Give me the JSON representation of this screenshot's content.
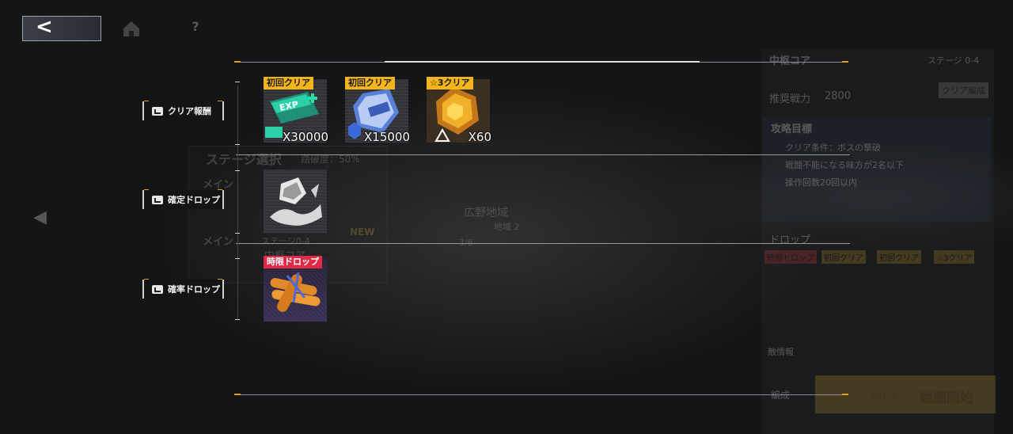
{
  "nav": {
    "back_icon": "chevron-left-icon",
    "home_icon": "home-icon",
    "help_label": "?"
  },
  "categories": [
    {
      "label": "クリア報酬"
    },
    {
      "label": "確定ドロップ"
    },
    {
      "label": "確率ドロップ"
    }
  ],
  "rewards": {
    "clear": [
      {
        "tag": "初回クリア",
        "qty": "X30000",
        "icon": "exp-ticket-icon"
      },
      {
        "tag": "初回クリア",
        "qty": "X15000",
        "icon": "silver-gem-icon"
      },
      {
        "tag": "☆3クリア",
        "qty": "X60",
        "icon": "gold-gem-icon"
      }
    ],
    "guaranteed": [
      {
        "icon": "silver-fragment-icon"
      }
    ],
    "probability": [
      {
        "tag": "時限ドロップ",
        "icon": "bread-icon"
      }
    ]
  },
  "background": {
    "stage_select_title": "ステージ選択",
    "clear_rate": "踏破度：50%",
    "main_label_1": "メイン",
    "main_label_2": "メイン",
    "stage_code": "ステージ0-4",
    "stage_name": "中枢コア",
    "new_badge": "NEW",
    "field_name": "広野地域",
    "field_sub": "地域 2",
    "count": "3/6",
    "right_panel": {
      "title": "中枢コア",
      "stage": "ステージ 0-4",
      "power_label": "推奨戦力",
      "power_value": "2800",
      "formation_button": "クリア編成",
      "goal_title": "攻略目標",
      "goals": [
        "クリア条件：ボスの撃破",
        "戦闘不能になる味方が2名以下",
        "操作回数20回以内"
      ],
      "drop_title": "ドロップ",
      "drop_tags": [
        "時限ドロップ",
        "初回クリア",
        "初回クリア",
        "☆3クリア"
      ],
      "enemy_label": "敵情報",
      "lock_label": "編成",
      "fuel": "燃料 -6",
      "start_button": "戦闘開始"
    }
  },
  "colors": {
    "tag_gold": "#f3b41c",
    "tag_red": "#e02a48",
    "accent_tick": "#e0a020"
  }
}
